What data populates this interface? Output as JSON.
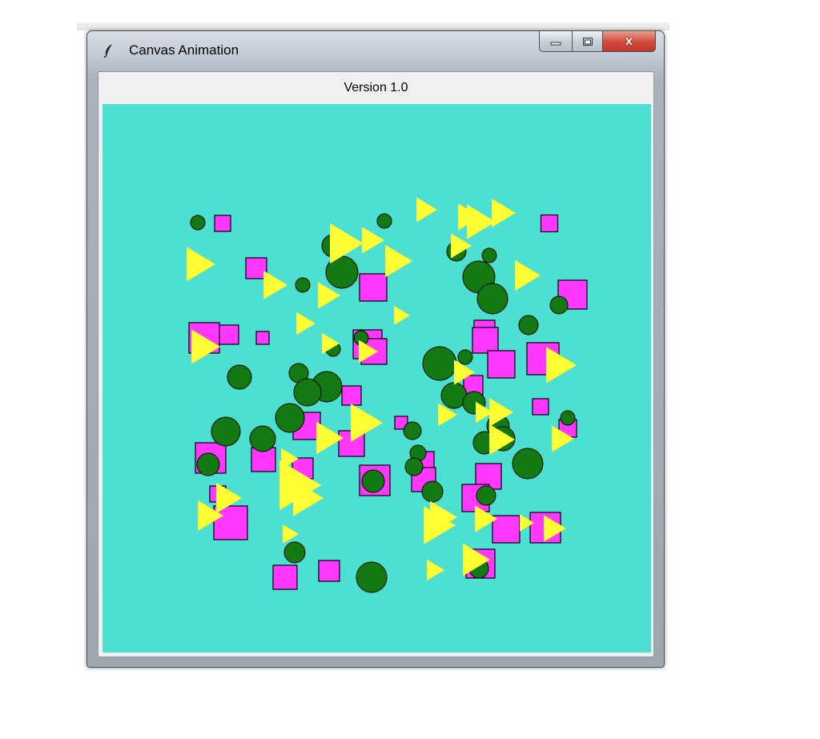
{
  "window": {
    "title": "Canvas Animation",
    "close_glyph": "x"
  },
  "header": {
    "version_label": "Version 1.0"
  },
  "icons": {
    "app": "feather-icon",
    "minimize": "minimize-icon",
    "maximize": "maximize-icon",
    "close": "close-icon"
  },
  "colors": {
    "canvas_bg": "#4ce0d2",
    "circle": "#137a13",
    "square": "#ff37ff",
    "triangle": "#ffff33",
    "close_button": "#d2493a"
  }
}
